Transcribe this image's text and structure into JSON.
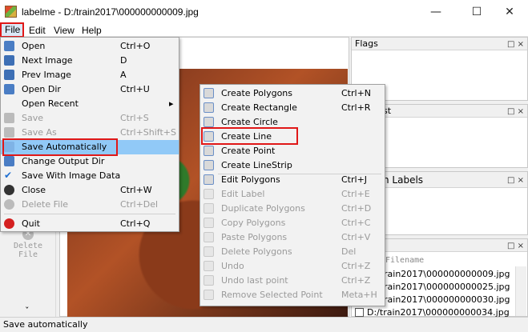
{
  "window": {
    "title": "labelme - D:/train2017\\000000000009.jpg",
    "min": "—",
    "max": "☐",
    "close": "✕"
  },
  "menubar": [
    "File",
    "Edit",
    "View",
    "Help"
  ],
  "toolbar": {
    "delete_file_label_1": "Delete",
    "delete_file_label_2": "File",
    "more": "ˇ"
  },
  "docks": {
    "flags": "Flags",
    "labels_partial": "st",
    "polygon_labels_partial": "n Labels",
    "file_list_header": "Filename",
    "dock_icons": "□ ×"
  },
  "file_list": [
    "rain2017\\000000000009.jpg",
    "rain2017\\000000000025.jpg",
    "rain2017\\000000000030.jpg",
    "D:/train2017\\000000000034.jpg"
  ],
  "file_menu": [
    {
      "label": "Open",
      "shortcut": "Ctrl+O",
      "enabled": true,
      "icon": "open-folder-icon"
    },
    {
      "label": "Next Image",
      "shortcut": "D",
      "enabled": true,
      "icon": "arrow-right-icon"
    },
    {
      "label": "Prev Image",
      "shortcut": "A",
      "enabled": true,
      "icon": "arrow-left-icon"
    },
    {
      "label": "Open Dir",
      "shortcut": "Ctrl+U",
      "enabled": true,
      "icon": "open-dir-icon"
    },
    {
      "label": "Open Recent",
      "shortcut": "▸",
      "enabled": true,
      "icon": ""
    },
    {
      "label": "Save",
      "shortcut": "Ctrl+S",
      "enabled": false,
      "icon": "save-icon"
    },
    {
      "label": "Save As",
      "shortcut": "Ctrl+Shift+S",
      "enabled": false,
      "icon": "save-as-icon"
    },
    {
      "label": "Save Automatically",
      "shortcut": "",
      "enabled": true,
      "icon": "checkbox-icon"
    },
    {
      "label": "Change Output Dir",
      "shortcut": "",
      "enabled": true,
      "icon": "output-dir-icon"
    },
    {
      "label": "Save With Image Data",
      "shortcut": "",
      "enabled": true,
      "icon": "check-icon"
    },
    {
      "label": "Close",
      "shortcut": "Ctrl+W",
      "enabled": true,
      "icon": "close-circle-icon"
    },
    {
      "label": "Delete File",
      "shortcut": "Ctrl+Del",
      "enabled": false,
      "icon": "delete-circle-icon"
    },
    {
      "label": "Quit",
      "shortcut": "Ctrl+Q",
      "enabled": true,
      "icon": "quit-icon"
    }
  ],
  "edit_menu": [
    {
      "label": "Create Polygons",
      "shortcut": "Ctrl+N",
      "enabled": true
    },
    {
      "label": "Create Rectangle",
      "shortcut": "Ctrl+R",
      "enabled": true
    },
    {
      "label": "Create Circle",
      "shortcut": "",
      "enabled": true
    },
    {
      "label": "Create Line",
      "shortcut": "",
      "enabled": true
    },
    {
      "label": "Create Point",
      "shortcut": "",
      "enabled": true
    },
    {
      "label": "Create LineStrip",
      "shortcut": "",
      "enabled": true
    },
    {
      "label": "Edit Polygons",
      "shortcut": "Ctrl+J",
      "enabled": true
    },
    {
      "label": "Edit Label",
      "shortcut": "Ctrl+E",
      "enabled": false
    },
    {
      "label": "Duplicate Polygons",
      "shortcut": "Ctrl+D",
      "enabled": false
    },
    {
      "label": "Copy Polygons",
      "shortcut": "Ctrl+C",
      "enabled": false
    },
    {
      "label": "Paste Polygons",
      "shortcut": "Ctrl+V",
      "enabled": false
    },
    {
      "label": "Delete Polygons",
      "shortcut": "Del",
      "enabled": false
    },
    {
      "label": "Undo",
      "shortcut": "Ctrl+Z",
      "enabled": false
    },
    {
      "label": "Undo last point",
      "shortcut": "Ctrl+Z",
      "enabled": false
    },
    {
      "label": "Remove Selected Point",
      "shortcut": "Meta+H",
      "enabled": false
    }
  ],
  "status": "Save automatically",
  "colors": {
    "highlight": "#91c9f7",
    "annotation": "#e01818"
  }
}
